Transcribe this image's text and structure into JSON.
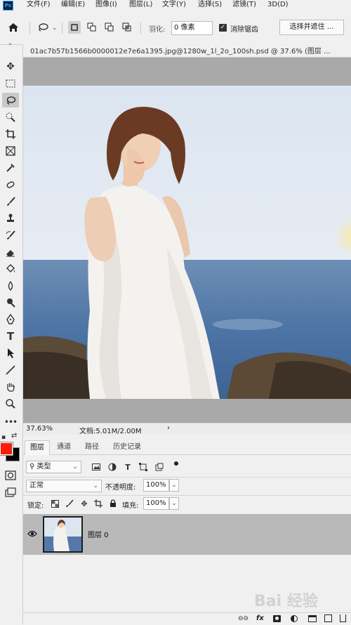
{
  "app": {
    "logo": "Ps"
  },
  "menu": [
    "文件(F)",
    "编辑(E)",
    "图像(I)",
    "图层(L)",
    "文字(Y)",
    "选择(S)",
    "滤镜(T)",
    "3D(D)"
  ],
  "options": {
    "feather_label": "羽化:",
    "feather_value": "0 像素",
    "antialias_label": "消除锯齿",
    "antialias_checked": true,
    "select_mask_label": "选择并遮住 ..."
  },
  "document": {
    "tab_title": "01ac7b57b1566b0000012e7e6a1395.jpg@1280w_1l_2o_100sh.psd @ 37.6% (图层 ..."
  },
  "status": {
    "zoom": "37.63%",
    "doc_info": "文档:5.01M/2.00M",
    "arrow": "›"
  },
  "layers_panel": {
    "tabs": [
      "图层",
      "通道",
      "路径",
      "历史记录"
    ],
    "active_tab": "图层",
    "filter_label": "类型",
    "blend_mode": "正常",
    "opacity_label": "不透明度:",
    "opacity_value": "100%",
    "lock_label": "锁定:",
    "fill_label": "填充:",
    "fill_value": "100%",
    "layers": [
      {
        "name": "图层 0",
        "visible": true
      }
    ]
  },
  "colors": {
    "foreground": "#ff1a0a",
    "background": "#000000",
    "accent_icon": "#31a8ff"
  },
  "watermark": {
    "text": "Bai 经验"
  }
}
